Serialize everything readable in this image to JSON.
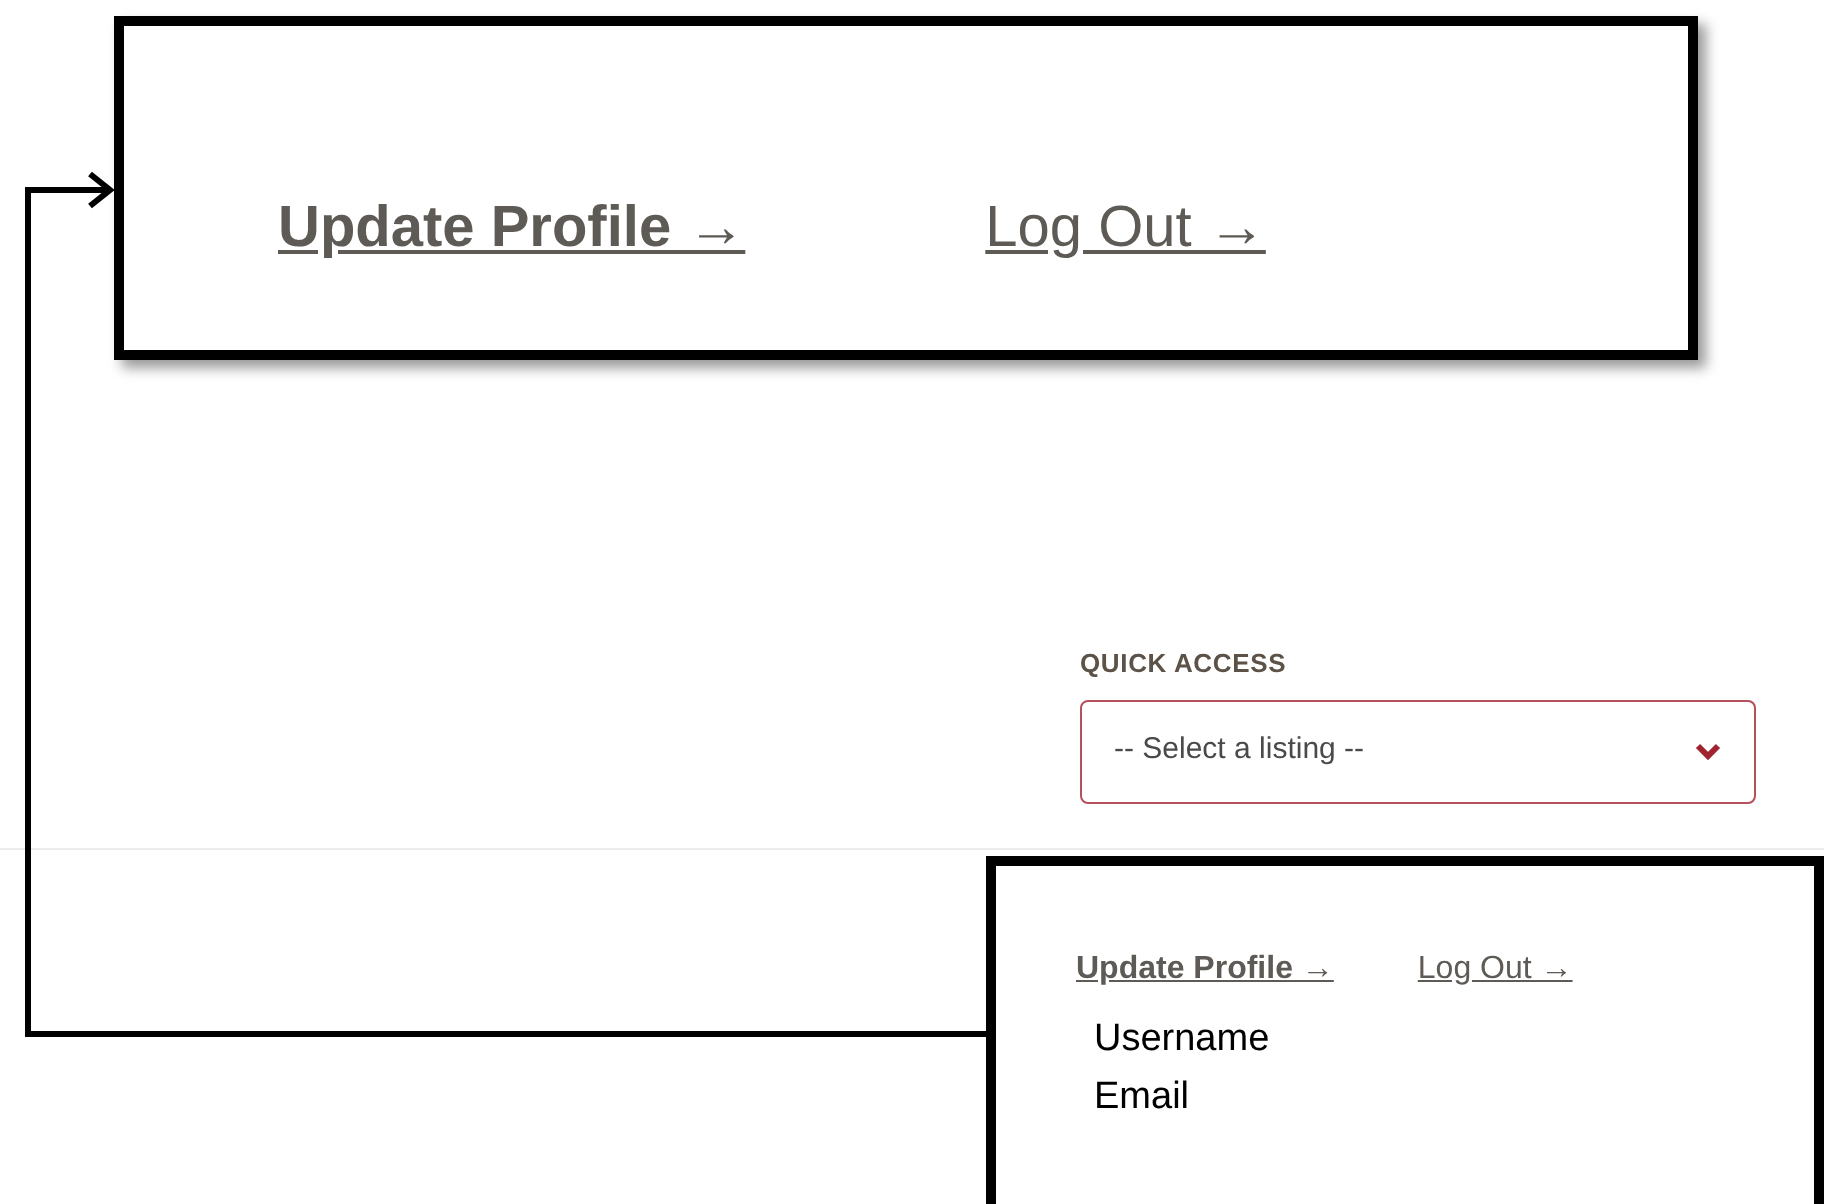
{
  "quick_access": {
    "label": "QUICK ACCESS",
    "select": {
      "value": "-- Select a listing --"
    }
  },
  "zoom_callout": {
    "links": [
      {
        "label": "Update Profile →",
        "bold": true
      },
      {
        "label": "Log Out →",
        "bold": false
      }
    ]
  },
  "detail_callout": {
    "links": [
      {
        "label": "Update Profile →",
        "bold": true
      },
      {
        "label": "Log Out →",
        "bold": false
      }
    ],
    "notes": [
      "Username",
      "Email"
    ]
  }
}
